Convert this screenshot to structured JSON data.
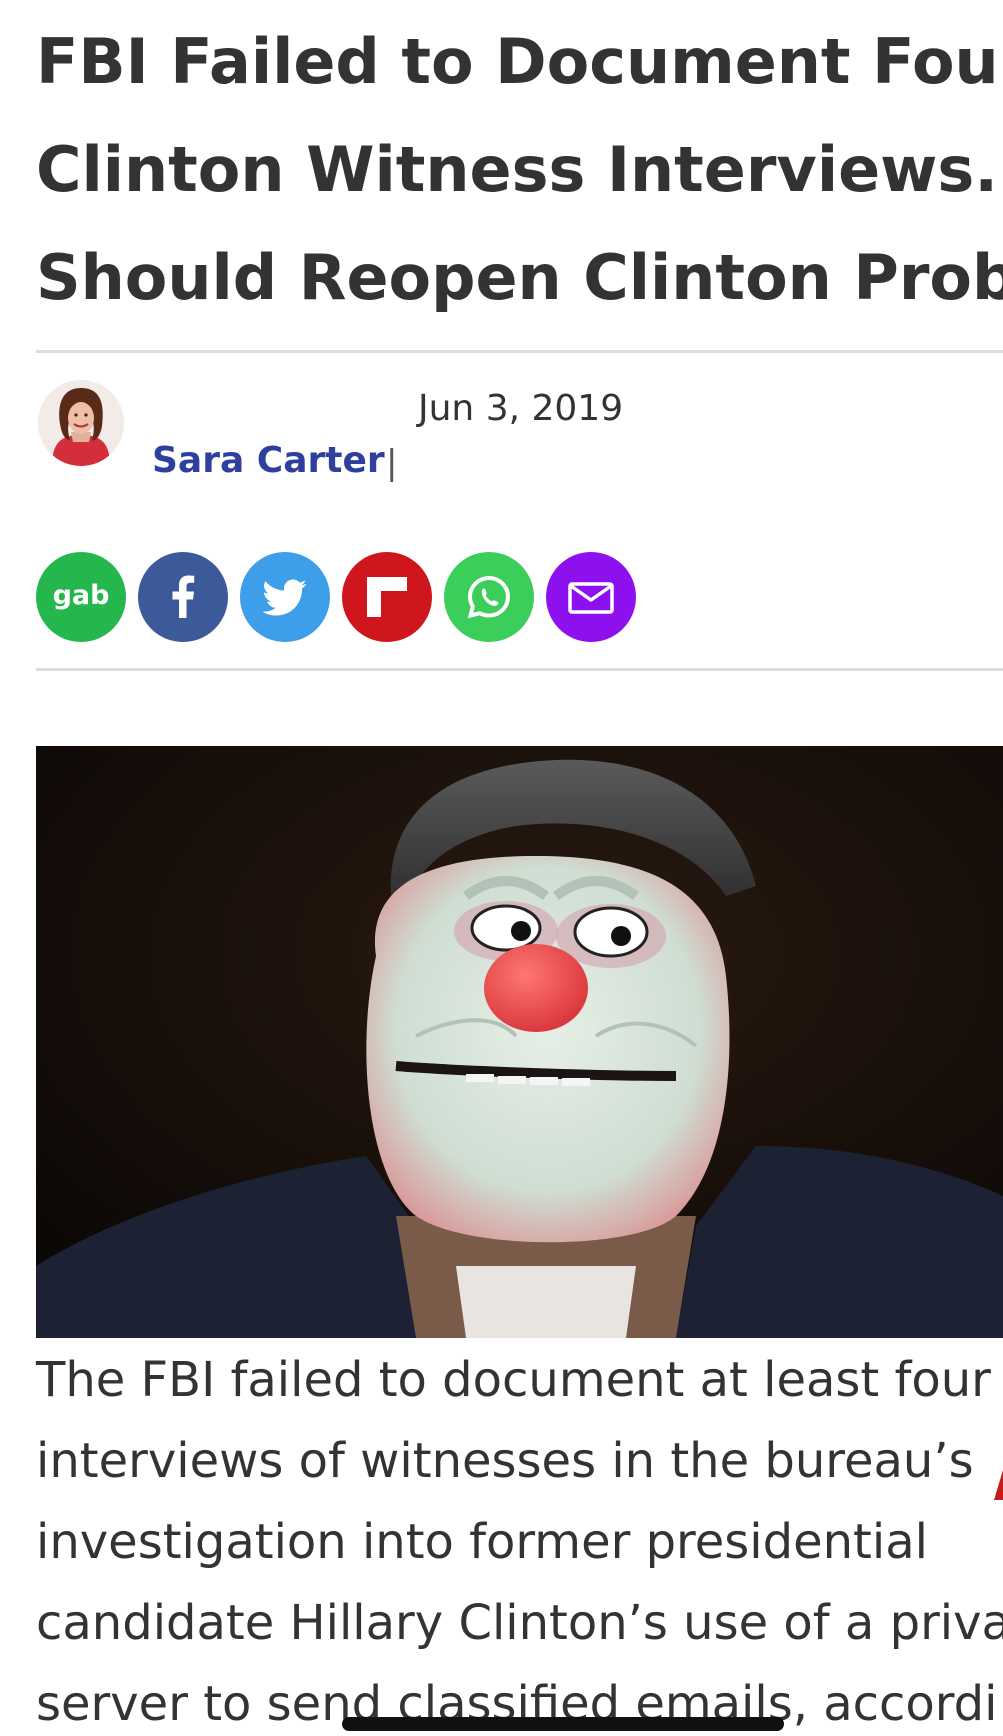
{
  "article": {
    "headline_lines": [
      "FBI Failed to Document Four",
      "Clinton Witness Interviews. Ba",
      "Should Reopen Clinton Probe."
    ],
    "date": "Jun 3, 2019",
    "author": "Sara Carter",
    "author_separator": "|",
    "body_lines": [
      "The FBI failed to document at least four",
      "interviews of witnesses in the bureau’s",
      "investigation into former presidential",
      "candidate Hillary Clinton’s use of a privat",
      "server to send classified emails, accordi"
    ]
  },
  "share": {
    "gab_label": "gab",
    "buttons": [
      {
        "name": "gab",
        "icon": "gab-icon",
        "color": "#25b74e"
      },
      {
        "name": "facebook",
        "icon": "facebook-icon",
        "color": "#3c5a9a"
      },
      {
        "name": "twitter",
        "icon": "twitter-bird-icon",
        "color": "#3d9ee9"
      },
      {
        "name": "flipboard",
        "icon": "flipboard-icon",
        "color": "#d0161d"
      },
      {
        "name": "whatsapp",
        "icon": "whatsapp-icon",
        "color": "#3cce5b"
      },
      {
        "name": "email",
        "icon": "envelope-icon",
        "color": "#8d10ee"
      }
    ]
  },
  "colors": {
    "headline": "#333333",
    "author_link": "#2f3f9e",
    "divider": "#dddddd"
  }
}
